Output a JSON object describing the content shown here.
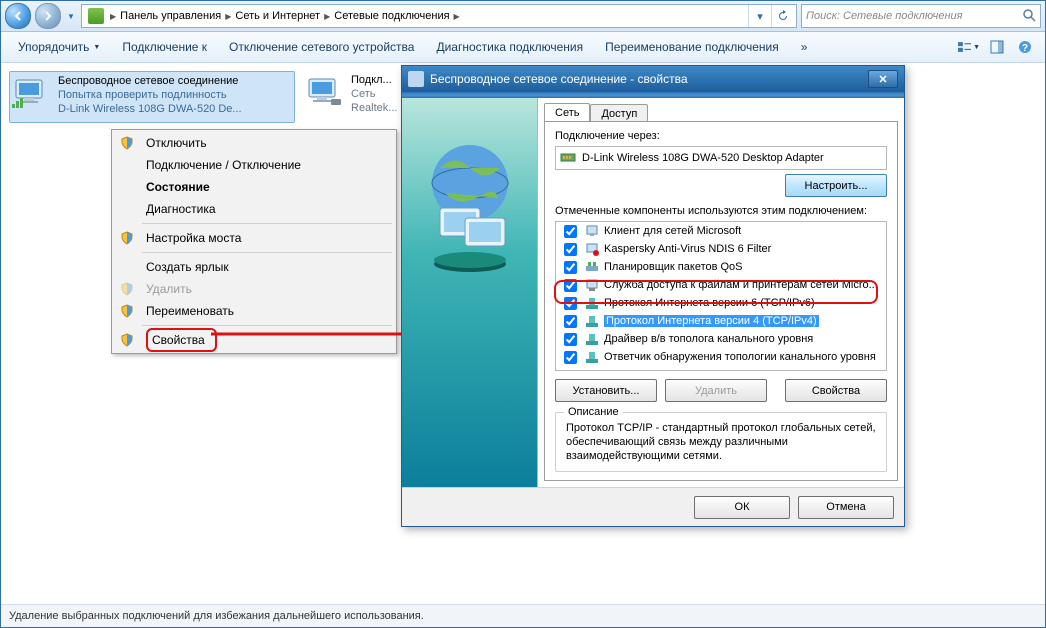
{
  "breadcrumb": {
    "p1": "Панель управления",
    "p2": "Сеть и Интернет",
    "p3": "Сетевые подключения"
  },
  "search": {
    "placeholder": "Поиск: Сетевые подключения"
  },
  "toolbar": {
    "organize": "Упорядочить",
    "connect": "Подключение к",
    "disable": "Отключение сетевого устройства",
    "diagnose": "Диагностика подключения",
    "rename": "Переименование подключения",
    "more": "»"
  },
  "cards": [
    {
      "t1": "Беспроводное сетевое соединение",
      "t2": "Попытка проверить подлинность",
      "t3": "D-Link Wireless 108G DWA-520 De..."
    },
    {
      "t1": "Подкл...",
      "t2": "Сеть",
      "t3": "Realtek..."
    }
  ],
  "ctx": {
    "disable": "Отключить",
    "connDisc": "Подключение / Отключение",
    "status": "Состояние",
    "diagnose": "Диагностика",
    "bridge": "Настройка моста",
    "shortcut": "Создать ярлык",
    "delete": "Удалить",
    "rename": "Переименовать",
    "properties": "Свойства"
  },
  "dialog": {
    "title": "Беспроводное сетевое соединение - свойства",
    "tab_net": "Сеть",
    "tab_access": "Доступ",
    "conn_via": "Подключение через:",
    "adapter": "D-Link Wireless 108G DWA-520 Desktop Adapter",
    "configure": "Настроить...",
    "comp_label": "Отмеченные компоненты используются этим подключением:",
    "components": [
      "Клиент для сетей Microsoft",
      "Kaspersky Anti-Virus NDIS 6 Filter",
      "Планировщик пакетов QoS",
      "Служба доступа к файлам и принтерам сетей Micro...",
      "Протокол Интернета версии 6 (TCP/IPv6)",
      "Протокол Интернета версии 4 (TCP/IPv4)",
      "Драйвер в/в тополога канального уровня",
      "Ответчик обнаружения топологии канального уровня"
    ],
    "install": "Установить...",
    "uninstall": "Удалить",
    "props": "Свойства",
    "desc_title": "Описание",
    "desc_text": "Протокол TCP/IP - стандартный протокол глобальных сетей, обеспечивающий связь между различными взаимодействующими сетями.",
    "ok": "ОК",
    "cancel": "Отмена"
  },
  "status": "Удаление выбранных подключений для избежания дальнейшего использования."
}
